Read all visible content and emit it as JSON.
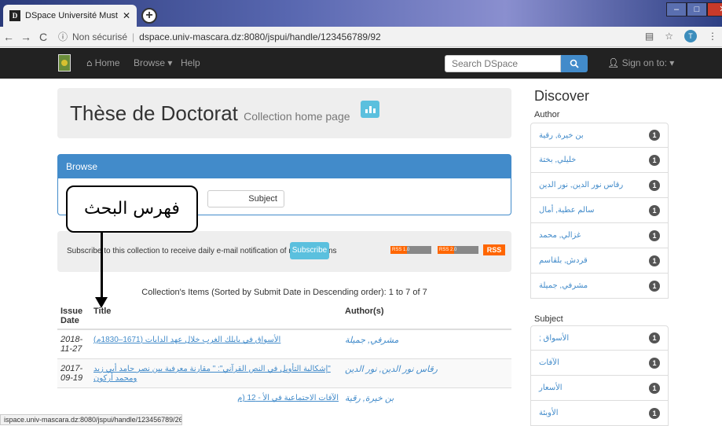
{
  "browser": {
    "tab_title": "DSpace Université Mustapha Sta",
    "tab_icon_letter": "D",
    "new_tab": "+",
    "address_info": "Non sécurisé",
    "url": "dspace.univ-mascara.dz:8080/jspui/handle/123456789/92",
    "profile_initial": "T",
    "status_url": "ispace.univ-mascara.dz:8080/jspui/handle/123456789/269"
  },
  "navbar": {
    "home": "Home",
    "browse": "Browse",
    "help": "Help",
    "search_placeholder": "Search DSpace",
    "sign_on": "Sign on to:"
  },
  "collection": {
    "title": "Thèse de Doctorat",
    "subtitle": "Collection home page",
    "browse_heading": "Browse",
    "browse_button": "Subject",
    "subscribe_text": "Subscribe to this collection to receive daily e-mail notification of new additions",
    "subscribe_button": "Subscribe",
    "rss_labels": [
      "RSS 1.0",
      "RSS 2.0",
      "RSS"
    ],
    "items_heading": "Collection's Items (Sorted by Submit Date in Descending order): 1 to 7 of 7"
  },
  "table": {
    "headers": [
      "Issue Date",
      "Title",
      "Author(s)"
    ],
    "rows": [
      {
        "date_top": "2018-",
        "date_bottom": "11-27",
        "title": "الأسواق في بايلك الغرب خلال عهد الدايات (1671–1830م)",
        "author": "مشرفي, جميلة"
      },
      {
        "date_top": "2017-",
        "date_bottom": "09-19",
        "title": "\"إشكالية التأويل في النص القرآني\": \" مقارنة معرفية بين نصر حامد أبي زيد ومحمد أركون",
        "author": "رقاس نور الدين, نور الدين"
      },
      {
        "date_top": "",
        "date_bottom": "",
        "title": "الآفات الاجتماعية في الأ - 12 (م",
        "author": "بن خيرة, رقية"
      }
    ]
  },
  "annotation": {
    "callout_text": "فهرس البحث"
  },
  "discover": {
    "heading": "Discover",
    "author_heading": "Author",
    "authors": [
      {
        "name": "بن خيرة, رقية",
        "count": "1"
      },
      {
        "name": "خليلي, بختة",
        "count": "1"
      },
      {
        "name": "رقاس نور الدين, نور الدين",
        "count": "1"
      },
      {
        "name": "سالم عطية, أمال",
        "count": "1"
      },
      {
        "name": "غزالي, محمد",
        "count": "1"
      },
      {
        "name": "قردش, بلقاسم",
        "count": "1"
      },
      {
        "name": "مشرفي, جميلة",
        "count": "1"
      }
    ],
    "subject_heading": "Subject",
    "subjects": [
      {
        "name": "الأسواق ;",
        "count": "1"
      },
      {
        "name": "الآفات",
        "count": "1"
      },
      {
        "name": "الأسعار",
        "count": "1"
      },
      {
        "name": "الأوبئة",
        "count": "1"
      }
    ]
  },
  "colors": {
    "navbar": "#222222",
    "primary": "#428bca",
    "info": "#5bc0de",
    "rss": "#ff6600"
  }
}
